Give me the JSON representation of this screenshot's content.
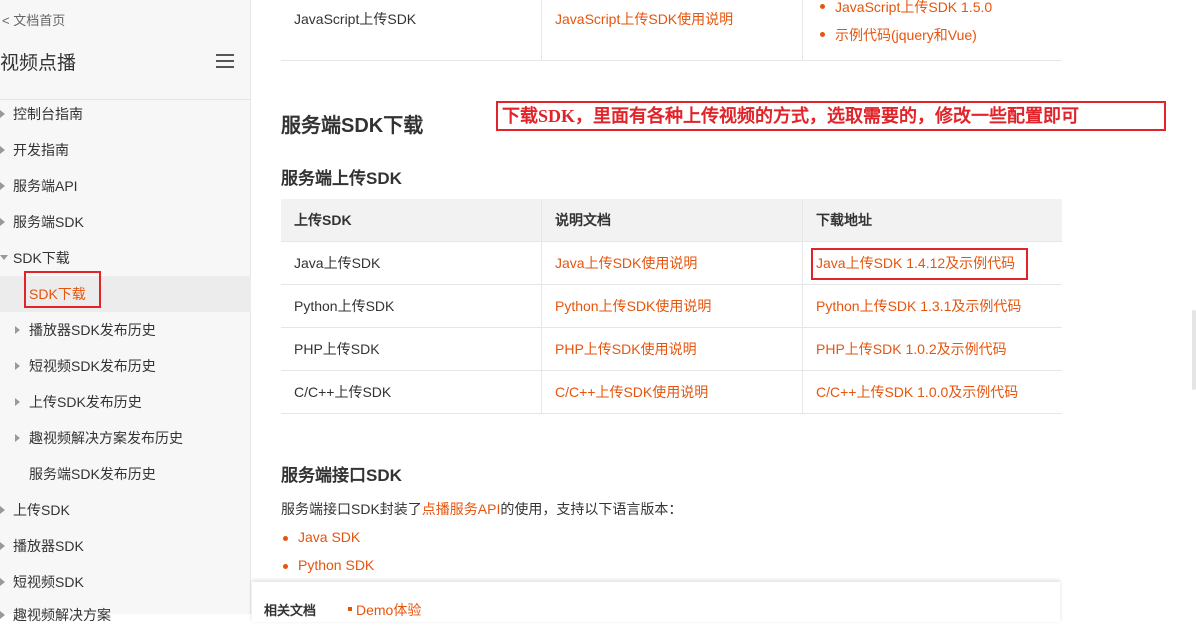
{
  "sidebar": {
    "back_link": "< 文档首页",
    "title": "视频点播",
    "items": [
      {
        "label": "控制台指南"
      },
      {
        "label": "开发指南"
      },
      {
        "label": "服务端API"
      },
      {
        "label": "服务端SDK"
      },
      {
        "label": "SDK下载"
      },
      {
        "label": "SDK下载"
      },
      {
        "label": "播放器SDK发布历史"
      },
      {
        "label": "短视频SDK发布历史"
      },
      {
        "label": "上传SDK发布历史"
      },
      {
        "label": "趣视频解决方案发布历史"
      },
      {
        "label": "服务端SDK发布历史"
      },
      {
        "label": "上传SDK"
      },
      {
        "label": "播放器SDK"
      },
      {
        "label": "短视频SDK"
      },
      {
        "label": "趣视频解决方案"
      }
    ]
  },
  "top_table": {
    "name": "JavaScript上传SDK",
    "doc": "JavaScript上传SDK使用说明",
    "download_1": "JavaScript上传SDK 1.5.0",
    "download_2": "示例代码(jquery和Vue)"
  },
  "server_sdk": {
    "heading": "服务端SDK下载",
    "annotation": "下载SDK，里面有各种上传视频的方式，选取需要的，修改一些配置即可",
    "upload_heading": "服务端上传SDK",
    "columns": [
      "上传SDK",
      "说明文档",
      "下载地址"
    ],
    "rows": [
      {
        "name": "Java上传SDK",
        "doc": "Java上传SDK使用说明",
        "download": "Java上传SDK 1.4.12及示例代码"
      },
      {
        "name": "Python上传SDK",
        "doc": "Python上传SDK使用说明",
        "download": "Python上传SDK 1.3.1及示例代码"
      },
      {
        "name": "PHP上传SDK",
        "doc": "PHP上传SDK使用说明",
        "download": "PHP上传SDK 1.0.2及示例代码"
      },
      {
        "name": "C/C++上传SDK",
        "doc": "C/C++上传SDK使用说明",
        "download": "C/C++上传SDK 1.0.0及示例代码"
      }
    ]
  },
  "interface_sdk": {
    "heading": "服务端接口SDK",
    "desc_before": "服务端接口SDK封装了",
    "desc_link": "点播服务API",
    "desc_after": "的使用，支持以下语言版本：",
    "langs": [
      "Java SDK",
      "Python SDK"
    ]
  },
  "footer": {
    "related": "相关文档",
    "demo": "Demo体验"
  },
  "colors": {
    "accent": "#e6550d",
    "annotation": "#e0242a"
  }
}
